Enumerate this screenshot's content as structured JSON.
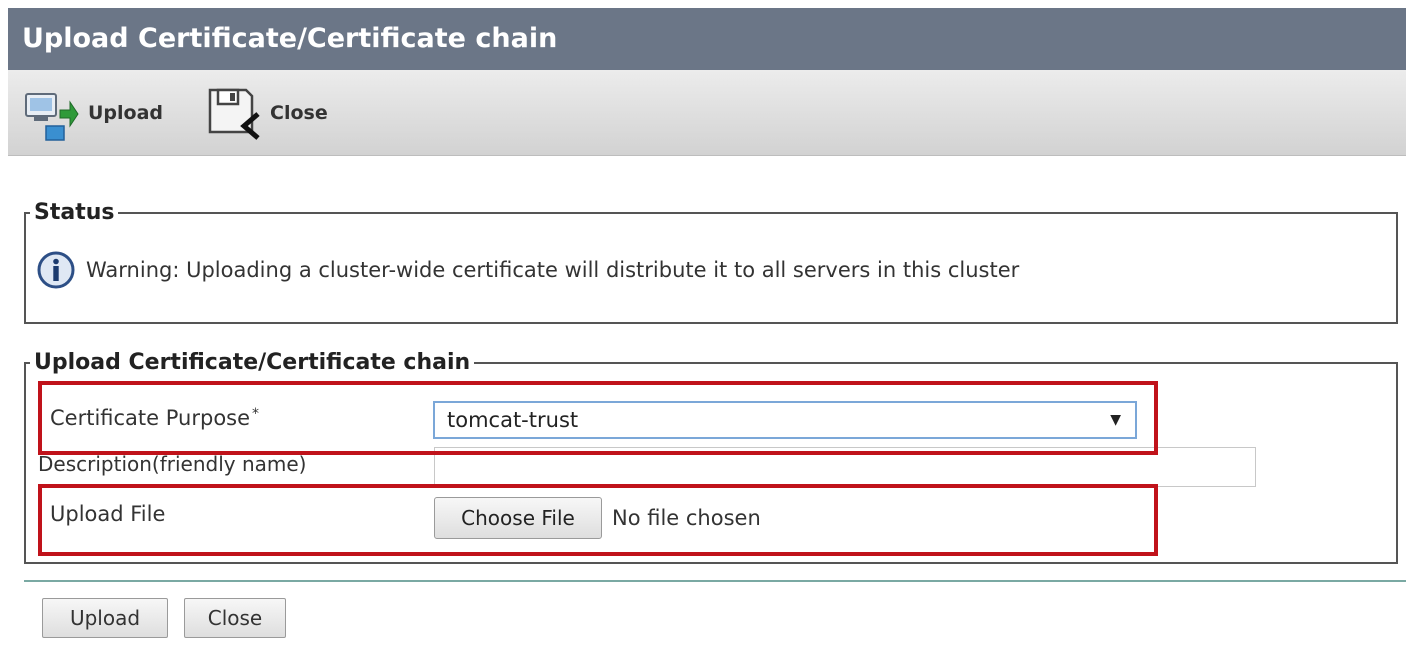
{
  "window": {
    "title": "Upload Certificate/Certificate chain"
  },
  "toolbar": {
    "upload_label": "Upload",
    "close_label": "Close",
    "upload_icon": "upload-icon",
    "close_icon": "close-icon"
  },
  "status": {
    "legend": "Status",
    "icon": "info-icon",
    "message": "Warning: Uploading a cluster-wide certificate will distribute it to all servers in this cluster"
  },
  "upload_section": {
    "legend": "Upload Certificate/Certificate chain",
    "purpose_label": "Certificate Purpose",
    "required_mark": "*",
    "purpose_value": "tomcat-trust",
    "description_label": "Description(friendly name)",
    "description_value": "",
    "file_label": "Upload File",
    "choose_file_label": "Choose File",
    "file_status": "No file chosen"
  },
  "footer": {
    "upload_label": "Upload",
    "close_label": "Close"
  },
  "colors": {
    "title_bar": "#6b7687",
    "highlight": "#c0121a",
    "divider": "#7aa9a3",
    "select_border": "#7ba7d8"
  }
}
